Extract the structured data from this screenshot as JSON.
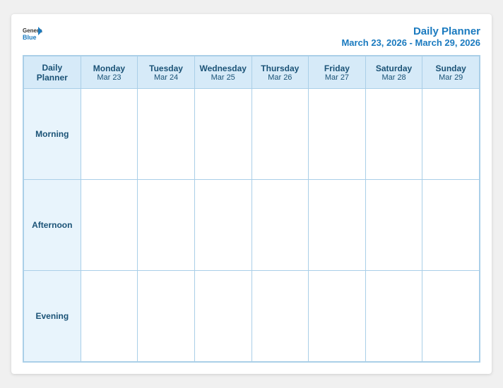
{
  "header": {
    "logo_general": "General",
    "logo_blue": "Blue",
    "title": "Daily Planner",
    "date_range": "March 23, 2026 - March 29, 2026"
  },
  "grid": {
    "first_col_label_line1": "Daily",
    "first_col_label_line2": "Planner",
    "columns": [
      {
        "day": "Monday",
        "date": "Mar 23"
      },
      {
        "day": "Tuesday",
        "date": "Mar 24"
      },
      {
        "day": "Wednesday",
        "date": "Mar 25"
      },
      {
        "day": "Thursday",
        "date": "Mar 26"
      },
      {
        "day": "Friday",
        "date": "Mar 27"
      },
      {
        "day": "Saturday",
        "date": "Mar 28"
      },
      {
        "day": "Sunday",
        "date": "Mar 29"
      }
    ],
    "rows": [
      {
        "label": "Morning"
      },
      {
        "label": "Afternoon"
      },
      {
        "label": "Evening"
      }
    ]
  }
}
